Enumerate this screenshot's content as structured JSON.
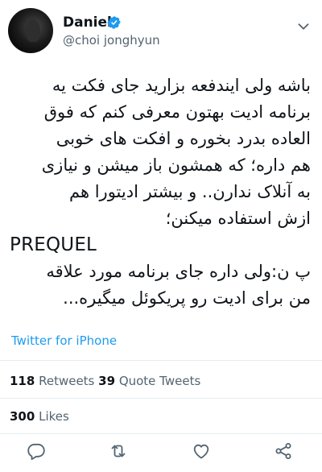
{
  "author": {
    "name": "Daniel",
    "handle": "@choi jonghyun",
    "verified": true
  },
  "tweet": {
    "text_persian": "باشه ولی ایندفعه بزارید جای فکت یه\nبرنامه ادیت بهتون معرفی کنم که فوق\nالعاده بدرد بخوره و افکت های خوبی\nهم داره؛ که همشون باز میشن و نیازی\nبه آنلاک ندارن.. و بیشتر ادیتورا هم\nازش استفاده میکنن؛",
    "app_name": "PREQUEL",
    "text_note": "پ ن:ولی داره جای برنامه مورد علاقه\nمن برای ادیت رو پریکوئل میگیره..."
  },
  "source": "Twitter for iPhone",
  "stats": {
    "retweets_count": "118",
    "retweets_label": "Retweets",
    "quotes_count": "39",
    "quotes_label": "Quote Tweets",
    "likes_count": "300",
    "likes_label": "Likes"
  },
  "icons": {
    "reply": "reply-icon",
    "retweet": "retweet-icon",
    "like": "like-icon",
    "share": "share-icon",
    "verified": "verified-badge-icon",
    "more": "more-icon"
  },
  "colors": {
    "accent": "#1d9bf0",
    "secondary_text": "#536471",
    "divider": "#e6ecf0"
  }
}
